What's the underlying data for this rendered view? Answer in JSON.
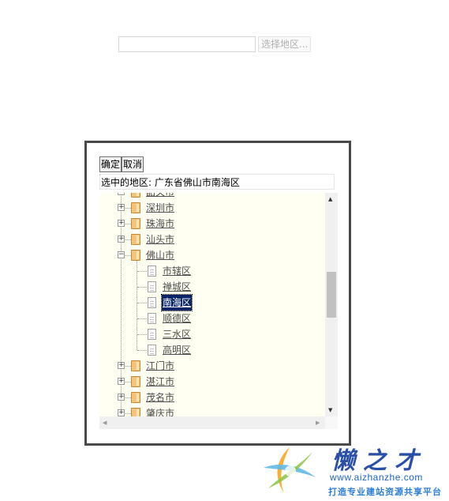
{
  "top_bar": {
    "region_input_value": "",
    "select_button_label": "选择地区..."
  },
  "dialog": {
    "ok_button_label": "确定",
    "cancel_button_label": "取消",
    "selected_line": "选中的地区: 广东省佛山市南海区",
    "tree": {
      "cities": [
        {
          "label": "韶关市",
          "expanded": false
        },
        {
          "label": "深圳市",
          "expanded": false
        },
        {
          "label": "珠海市",
          "expanded": false
        },
        {
          "label": "汕头市",
          "expanded": false
        },
        {
          "label": "佛山市",
          "expanded": true
        },
        {
          "label": "江门市",
          "expanded": false
        },
        {
          "label": "湛江市",
          "expanded": false
        },
        {
          "label": "茂名市",
          "expanded": false
        },
        {
          "label": "肇庆市",
          "expanded": false
        }
      ],
      "districts": [
        {
          "label": "市辖区",
          "selected": false
        },
        {
          "label": "禅城区",
          "selected": false
        },
        {
          "label": "南海区",
          "selected": true
        },
        {
          "label": "顺德区",
          "selected": false
        },
        {
          "label": "三水区",
          "selected": false
        },
        {
          "label": "高明区",
          "selected": false
        }
      ],
      "expand_symbol": "+",
      "collapse_symbol": "−"
    },
    "scrollbar_arrows": {
      "up": "▲",
      "down": "▼",
      "left": "◀",
      "right": "▶"
    }
  },
  "watermark": {
    "title": "懒之才",
    "url": "www.aizhanzhe.com",
    "slogan": "打造专业建站资源共享平台"
  }
}
